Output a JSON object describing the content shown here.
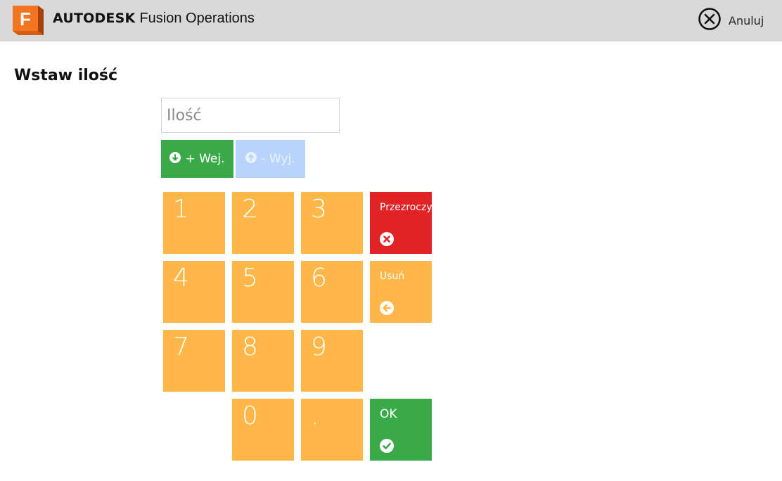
{
  "app": {
    "brand_bold": "AUTODESK",
    "brand_rest": "Fusion Operations",
    "logo_letter": "F",
    "logo_icon": "autodesk-f-logo-icon",
    "cancel_label": "Anuluj",
    "cancel_icon": "close-circle-icon"
  },
  "page": {
    "title": "Wstaw ilość"
  },
  "quantity_input": {
    "value": "",
    "placeholder": "Ilość"
  },
  "direction": {
    "in_label": "+ Wej.",
    "in_icon": "arrow-down-circle-icon",
    "out_label": "- Wyj.",
    "out_icon": "arrow-up-circle-icon"
  },
  "keypad": {
    "k1": "1",
    "k2": "2",
    "k3": "3",
    "k4": "4",
    "k5": "5",
    "k6": "6",
    "k7": "7",
    "k8": "8",
    "k9": "9",
    "k0": "0",
    "kdot": ".",
    "clear_label": "Przezroczy",
    "clear_icon": "x-circle-icon",
    "delete_label": "Usuń",
    "delete_icon": "arrow-left-circle-icon",
    "ok_label": "OK",
    "ok_icon": "check-circle-icon"
  },
  "colors": {
    "topbar": "#d9d9d9",
    "key_orange": "#ffb74a",
    "clear_red": "#e02426",
    "ok_green": "#3aaa48",
    "out_disabled_blue": "#b9d4fb"
  }
}
